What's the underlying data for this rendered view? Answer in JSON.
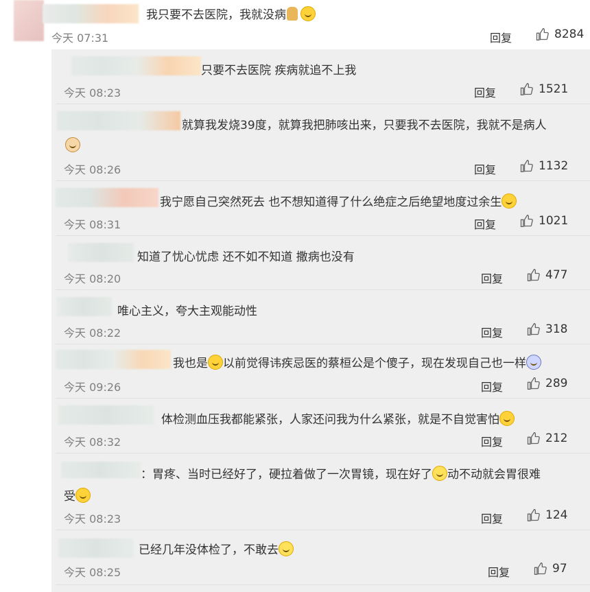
{
  "top_comment": {
    "text": "我只要不去医院，我就没病",
    "time": "今天 07:31",
    "reply_label": "回复",
    "likes": "8284"
  },
  "replies": [
    {
      "text": "只要不去医院 疾病就追不上我",
      "time": "今天 08:23",
      "reply_label": "回复",
      "likes": "1521"
    },
    {
      "text": "就算我发烧39度，就算我把肺咳出来，只要我不去医院，我就不是病人",
      "time": "今天 08:26",
      "reply_label": "回复",
      "likes": "1132"
    },
    {
      "text": "我宁愿自己突然死去 也不想知道得了什么绝症之后绝望地度过余生",
      "time": "今天 08:31",
      "reply_label": "回复",
      "likes": "1021"
    },
    {
      "text": "知道了忧心忧虑 还不如不知道 撒病也没有",
      "time": "今天 08:20",
      "reply_label": "回复",
      "likes": "477"
    },
    {
      "text": "唯心主义，夸大主观能动性",
      "time": "今天 08:22",
      "reply_label": "回复",
      "likes": "318"
    },
    {
      "text_a": "我也是",
      "text_b": "以前觉得讳疾忌医的蔡桓公是个傻子，现在发现自己也一样",
      "time": "今天 09:26",
      "reply_label": "回复",
      "likes": "289"
    },
    {
      "text": "体检测血压我都能紧张，人家还问我为什么紧张，就是不自觉害怕",
      "time": "今天 08:32",
      "reply_label": "回复",
      "likes": "212"
    },
    {
      "text_a": "：胃疼、当时已经好了，硬拉着做了一次胃镜，现在好了",
      "text_b": "动不动就会胃很难",
      "text_c": "受",
      "time": "今天 08:23",
      "reply_label": "回复",
      "likes": "124"
    },
    {
      "text": "已经几年没体检了，不敢去",
      "time": "今天 08:25",
      "reply_label": "回复",
      "likes": "97"
    }
  ],
  "icons": {
    "like": "thumbs-up-icon",
    "emoji_cry": "crying-laughing-emoji",
    "emoji_dog": "doge-emoji",
    "emoji_smile": "smile-emoji",
    "emoji_shock": "shocked-emoji",
    "emoji_sad": "tearful-emoji"
  },
  "colors": {
    "reply_bg": "#efefef",
    "time": "#808080",
    "text": "#333333"
  }
}
